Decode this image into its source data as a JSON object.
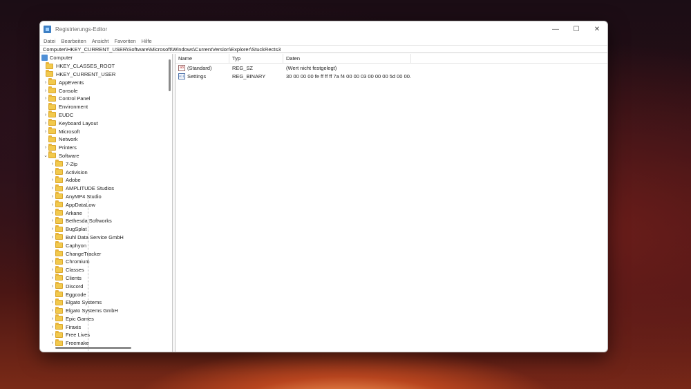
{
  "window": {
    "title": "Registrierungs-Editor",
    "controls": {
      "minimize": "—",
      "maximize": "☐",
      "close": "✕"
    }
  },
  "menu": [
    "Datei",
    "Bearbeiten",
    "Ansicht",
    "Favoriten",
    "Hilfe"
  ],
  "address": "Computer\\HKEY_CURRENT_USER\\Software\\Microsoft\\Windows\\CurrentVersion\\Explorer\\StuckRects3",
  "tree": {
    "root": "Computer",
    "hives": [
      "HKEY_CLASSES_ROOT",
      "HKEY_CURRENT_USER"
    ],
    "hkcu_children": [
      "AppEvents",
      "Console",
      "Control Panel",
      "Environment",
      "EUDC",
      "Keyboard Layout",
      "Microsoft",
      "Network",
      "Printers",
      "Software"
    ],
    "software_children": [
      "7-Zip",
      "Activision",
      "Adobe",
      "AMPLITUDE Studios",
      "AnyMP4 Studio",
      "AppDataLow",
      "Arkane",
      "Bethesda Softworks",
      "BugSplat",
      "Buhl Data Service GmbH",
      "Caphyon",
      "ChangeTracker",
      "Chromium",
      "Classes",
      "Clients",
      "Discord",
      "Eggcode",
      "Elgato Systems",
      "Elgato Systems GmbH",
      "Epic Games",
      "Firaxis",
      "Free Lives",
      "Freemake"
    ]
  },
  "values": {
    "columns": [
      "Name",
      "Typ",
      "Daten"
    ],
    "rows": [
      {
        "name": "(Standard)",
        "type": "REG_SZ",
        "data": "(Wert nicht festgelegt)",
        "icon": "string-value-icon"
      },
      {
        "name": "Settings",
        "type": "REG_BINARY",
        "data": "30 00 00 00 fe ff ff ff 7a f4 00 00 03 00 00 00 5d 00 00...",
        "icon": "binary-value-icon"
      }
    ]
  }
}
